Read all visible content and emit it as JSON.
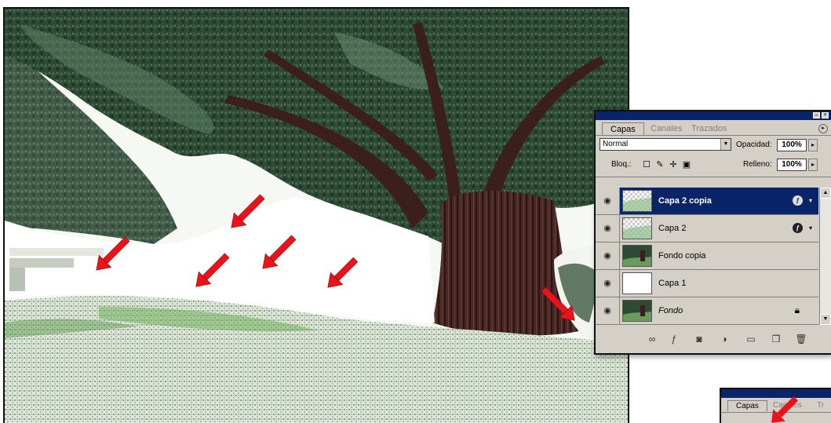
{
  "photo": {
    "description_alt": "",
    "arrow_color": "#e8141b"
  },
  "layers_panel": {
    "tabs": [
      {
        "label": "Capas",
        "active": true
      },
      {
        "label": "Canales",
        "active": false
      },
      {
        "label": "Trazados",
        "active": false
      }
    ],
    "blend_mode": "Normal",
    "opacity_label": "Opacidad:",
    "opacity_value": "100%",
    "lock_label": "Bloq.:",
    "fill_label": "Relleno:",
    "fill_value": "100%",
    "layers": [
      {
        "name": "Capa 2 copia",
        "selected": true,
        "has_fx": true
      },
      {
        "name": "Capa 2",
        "selected": false,
        "has_fx": true
      },
      {
        "name": "Fondo copia",
        "selected": false,
        "has_fx": false
      },
      {
        "name": "Capa 1",
        "selected": false,
        "has_fx": false
      },
      {
        "name": "Fondo",
        "selected": false,
        "has_fx": false,
        "locked": true
      }
    ],
    "selection_color": "#0a246a"
  },
  "second_panel": {
    "tabs": [
      {
        "label": "Capas"
      },
      {
        "label": "Canales"
      },
      {
        "label": "Tr"
      }
    ]
  }
}
